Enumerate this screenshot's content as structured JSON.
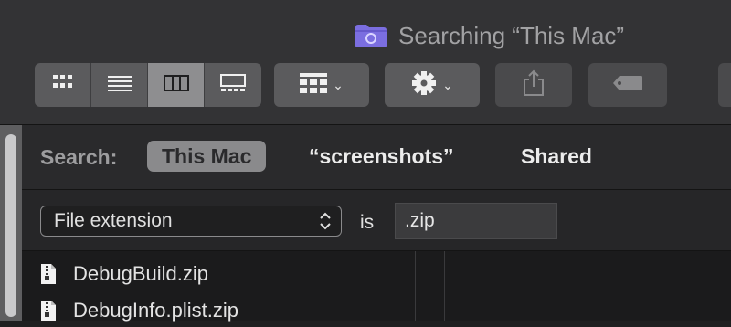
{
  "window": {
    "title": "Searching “This Mac”",
    "folder_icon": "smart-folder-icon",
    "folder_color": "#7b6ee0"
  },
  "toolbar": {
    "view_modes": [
      {
        "icon": "icon-view-icon",
        "selected": false
      },
      {
        "icon": "list-view-icon",
        "selected": false
      },
      {
        "icon": "column-view-icon",
        "selected": true
      },
      {
        "icon": "gallery-view-icon",
        "selected": false
      }
    ],
    "group_icon": "group-grid-icon",
    "action_icon": "gear-icon",
    "share_icon": "share-icon",
    "tag_icon": "tag-icon",
    "chevron": "⌄"
  },
  "search": {
    "label": "Search:",
    "scopes": [
      {
        "label": "This Mac",
        "selected": true
      },
      {
        "label": "“screenshots”",
        "selected": false
      },
      {
        "label": "Shared",
        "selected": false
      }
    ]
  },
  "criteria": {
    "attribute": "File extension",
    "operator": "is",
    "value": ".zip"
  },
  "results": [
    {
      "name": "DebugBuild.zip",
      "icon": "zip-file-icon"
    },
    {
      "name": "DebugInfo.plist.zip",
      "icon": "zip-file-icon"
    }
  ]
}
